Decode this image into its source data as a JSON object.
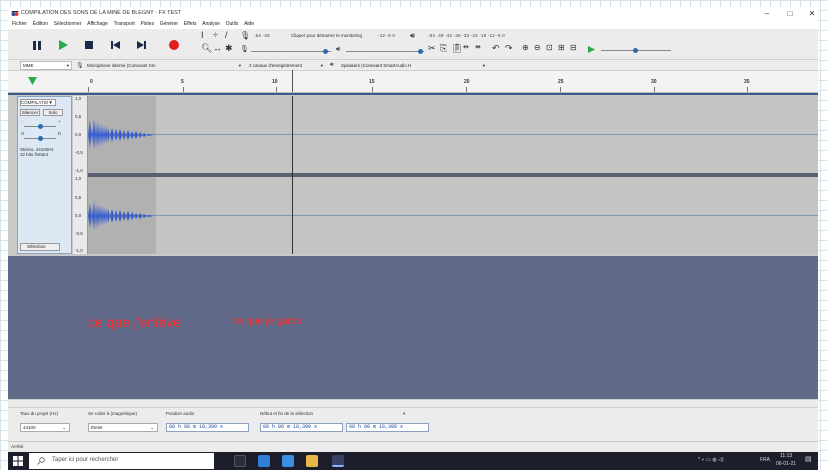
{
  "window": {
    "title": "COMPILATION DES SONS DE LA MINE DE BLEGNY - FX TEST",
    "minimize_label": "–",
    "maximize_label": "□",
    "close_label": "✕"
  },
  "menu": [
    "Fichier",
    "Édition",
    "Sélectionner",
    "Affichage",
    "Transport",
    "Pistes",
    "Générer",
    "Effets",
    "Analyse",
    "Outils",
    "Aide"
  ],
  "toolbar": {
    "monitor_label": "Cliquer pour démarrer le monitoring",
    "rec_meter_scale": "-54   -48",
    "rec_meter_scale2": "-12   -6   0",
    "play_meter_scale": "-54   -48   -42   -36   -30   -24   -18   -12   -6   0",
    "lr": "G\nD"
  },
  "devices": {
    "host": "MME",
    "recording_device": "Microphone interne (Conexant Sm",
    "channels": "2 canaux d'enregistrement",
    "playback_device": "Speakers (Conexant SmartAudio H"
  },
  "ruler": {
    "ticks": [
      "0",
      "5",
      "10",
      "15",
      "20",
      "25",
      "30",
      "35"
    ]
  },
  "track": {
    "name": "COMPILATIO▼",
    "mute": "Silencer",
    "solo": "Solo",
    "gain_minus": "-",
    "gain_plus": "+",
    "pan_left": "G",
    "pan_right": "D",
    "info_line1": "Stéréo, 44100Hz",
    "info_line2": "32 bits flottant",
    "select_label": "Sélection",
    "scale": [
      "1,0",
      "0,5",
      "0,0",
      "-0,5",
      "-1,0",
      "1,0",
      "0,5",
      "0,0",
      "-0,5",
      "-1,0"
    ]
  },
  "annotations": {
    "left": "ce que j'enlève",
    "right": "ce que je garde"
  },
  "selection_bar": {
    "rate_label": "Taux du projet (Hz)",
    "snap_label": "Se coller à (magnétique)",
    "position_label": "Position audio",
    "range_label": "Début et fin de la sélection",
    "rate_value": "44100",
    "snap_value": "Éteint",
    "position_value": "00 h 00 m 10,390 s",
    "start_value": "00 h 00 m 10,390 s",
    "end_value": "00 h 00 m 10,390 s"
  },
  "status": "Arrêté.",
  "taskbar": {
    "search_placeholder": "Taper ici pour rechercher",
    "tray_text": "FRA",
    "time": "11:13",
    "date": "06-01-21"
  },
  "colors": {
    "waveform": "#3a5fcd",
    "annotation": "#ff2a2a",
    "empty_area": "#606a88"
  }
}
